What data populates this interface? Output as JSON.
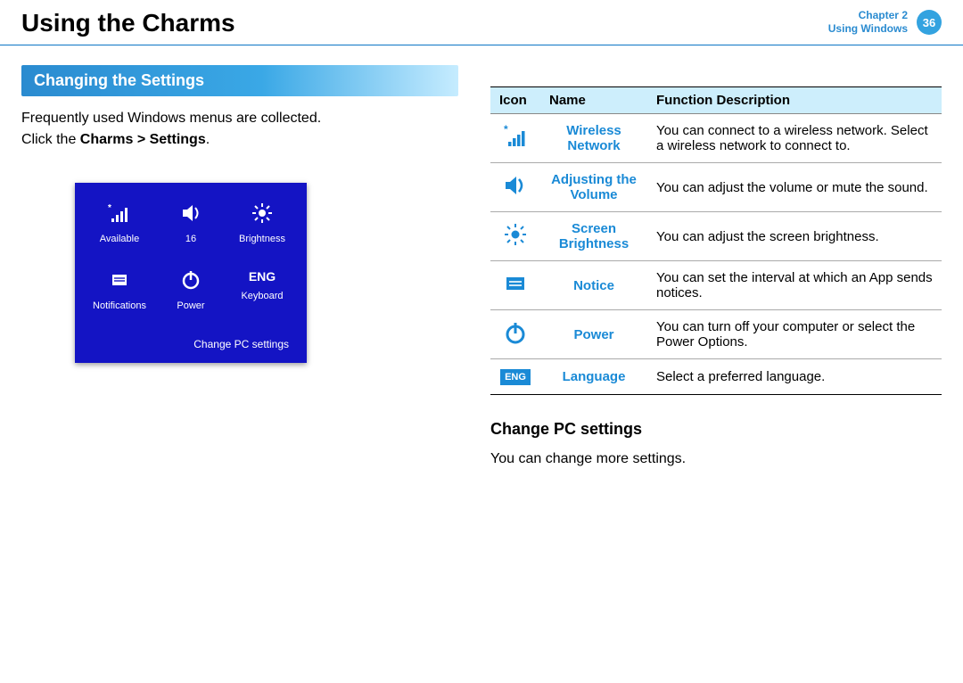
{
  "header": {
    "title": "Using the Charms",
    "chapter_line1": "Chapter 2",
    "chapter_line2": "Using Windows",
    "page_num": "36"
  },
  "left": {
    "section_title": "Changing the Settings",
    "p1": "Frequently used Windows menus are collected.",
    "p2_prefix": "Click the ",
    "p2_bold": "Charms > Settings",
    "p2_suffix": ".",
    "panel": {
      "tiles": {
        "wifi": "Available",
        "volume": "16",
        "brightness": "Brightness",
        "notifications": "Notifications",
        "power": "Power",
        "keyboard_icon": "ENG",
        "keyboard": "Keyboard"
      },
      "footer": "Change PC settings"
    }
  },
  "right": {
    "table": {
      "headers": {
        "icon": "Icon",
        "name": "Name",
        "desc": "Function Description"
      },
      "rows": [
        {
          "name": "Wireless Network",
          "desc": "You can connect to a wireless network. Select a wireless network to connect to."
        },
        {
          "name": "Adjusting the Volume",
          "desc": "You can adjust the volume or mute the sound."
        },
        {
          "name": "Screen Brightness",
          "desc": "You can adjust the screen brightness."
        },
        {
          "name": "Notice",
          "desc": "You can set the interval at which an App sends notices."
        },
        {
          "name": "Power",
          "desc": "You can turn off your computer or select the Power Options."
        },
        {
          "name": "Language",
          "desc": "Select a preferred language.",
          "chip": "ENG"
        }
      ]
    },
    "subhead": "Change PC settings",
    "subtext": "You can change more settings."
  }
}
